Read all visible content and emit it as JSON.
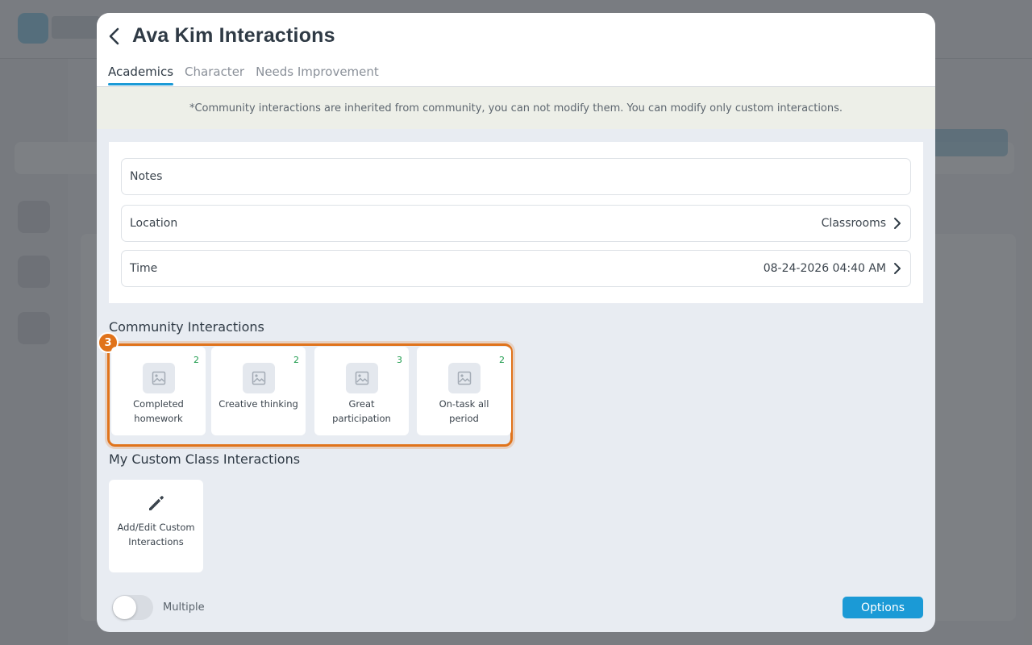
{
  "modal": {
    "title": "Ava Kim Interactions",
    "tabs": [
      {
        "label": "Academics",
        "active": true
      },
      {
        "label": "Character",
        "active": false
      },
      {
        "label": "Needs Improvement",
        "active": false
      }
    ],
    "notice": "*Community interactions are inherited from community, you can not modify them. You can modify only custom interactions.",
    "fields": {
      "notes": {
        "label": "Notes"
      },
      "location": {
        "label": "Location",
        "value": "Classrooms"
      },
      "time": {
        "label": "Time",
        "value": "08-24-2026 04:40 AM"
      }
    },
    "community": {
      "title": "Community Interactions",
      "step_badge": "3",
      "items": [
        {
          "name": "Completed homework",
          "count": "2"
        },
        {
          "name": "Creative thinking",
          "count": "2"
        },
        {
          "name": "Great participation",
          "count": "3"
        },
        {
          "name": "On-task all period",
          "count": "2"
        }
      ]
    },
    "custom": {
      "title": "My Custom Class Interactions",
      "add_edit_label": "Add/Edit Custom Interactions"
    },
    "footer": {
      "multiple_label": "Multiple",
      "multiple_on": false,
      "options_label": "Options"
    }
  },
  "colors": {
    "accent": "#1b9ad6",
    "highlight": "#e0731b",
    "count": "#1d9b4c"
  },
  "icons": [
    "chevron-left-icon",
    "chevron-right-icon",
    "image-placeholder-icon",
    "pencil-icon"
  ]
}
